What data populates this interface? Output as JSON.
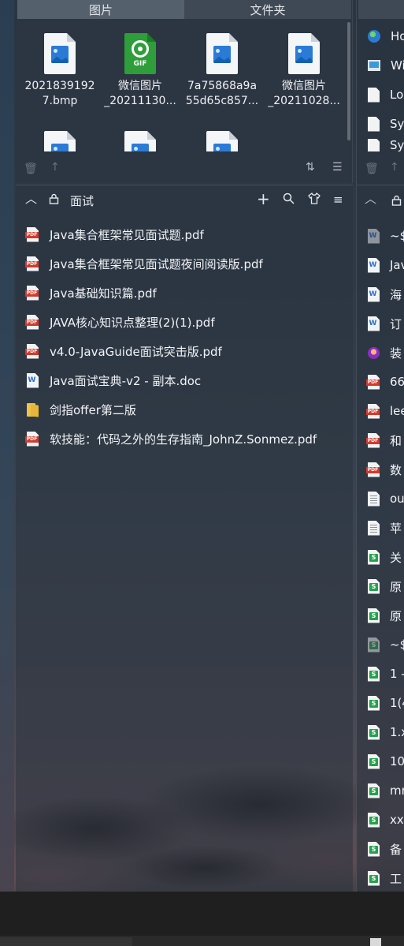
{
  "top_fence": {
    "tabs": [
      {
        "label": "图片",
        "active": true
      },
      {
        "label": "文件夹",
        "active": false
      }
    ],
    "files": [
      {
        "name": "2021839192\n7.bmp",
        "icon": "image-file-icon"
      },
      {
        "name": "微信图片\n_20211130...",
        "icon": "gif-file-icon"
      },
      {
        "name": "7a75868a9a\n55d65c857...",
        "icon": "image-file-icon"
      },
      {
        "name": "微信图片\n_20211028...",
        "icon": "image-file-icon"
      }
    ]
  },
  "main_fence": {
    "title": "面试",
    "items": [
      {
        "name": "Java集合框架常见面试题.pdf",
        "type": "pdf"
      },
      {
        "name": "Java集合框架常见面试题夜间阅读版.pdf",
        "type": "pdf"
      },
      {
        "name": "Java基础知识篇.pdf",
        "type": "pdf"
      },
      {
        "name": "JAVA核心知识点整理(2)(1).pdf",
        "type": "pdf"
      },
      {
        "name": "v4.0-JavaGuide面试突击版.pdf",
        "type": "pdf"
      },
      {
        "name": "Java面试宝典-v2  - 副本.doc",
        "type": "doc"
      },
      {
        "name": "剑指offer第二版",
        "type": "folder"
      },
      {
        "name": "软技能：代码之外的生存指南_JohnZ.Sonmez.pdf",
        "type": "pdf"
      }
    ]
  },
  "right_fence": {
    "top_items": [
      {
        "name": "Ho",
        "type": "globe"
      },
      {
        "name": "Wi",
        "type": "app"
      },
      {
        "name": "Lo",
        "type": "pdf-red"
      },
      {
        "name": "Sy",
        "type": "pdf-red"
      },
      {
        "name": "Sy",
        "type": "pdf-red"
      }
    ],
    "items": [
      {
        "name": "~$",
        "type": "doc-dim"
      },
      {
        "name": "Jav",
        "type": "doc"
      },
      {
        "name": "海",
        "type": "doc"
      },
      {
        "name": "订",
        "type": "doc"
      },
      {
        "name": "装",
        "type": "avatar"
      },
      {
        "name": "66",
        "type": "pdf"
      },
      {
        "name": "lee",
        "type": "pdf"
      },
      {
        "name": "和",
        "type": "pdf"
      },
      {
        "name": "数",
        "type": "pdf"
      },
      {
        "name": "ou",
        "type": "txt"
      },
      {
        "name": "苹",
        "type": "txt"
      },
      {
        "name": "关",
        "type": "sheet"
      },
      {
        "name": "原",
        "type": "sheet"
      },
      {
        "name": "原",
        "type": "sheet"
      },
      {
        "name": "~$",
        "type": "sheet-dim"
      },
      {
        "name": "1 -",
        "type": "sheet"
      },
      {
        "name": "1(4",
        "type": "sheet"
      },
      {
        "name": "1.x",
        "type": "sheet"
      },
      {
        "name": "10",
        "type": "sheet"
      },
      {
        "name": "mr",
        "type": "sheet"
      },
      {
        "name": "xx",
        "type": "sheet"
      },
      {
        "name": "备",
        "type": "sheet"
      },
      {
        "name": "工",
        "type": "sheet"
      }
    ]
  },
  "icons": {
    "delete": "🗑",
    "up": "↑",
    "sort": "⇅",
    "list": "☰",
    "collapse": "︿",
    "lock": "🔒",
    "add": "+",
    "search": "⌕",
    "shirt": "♲",
    "menu": "≡"
  }
}
